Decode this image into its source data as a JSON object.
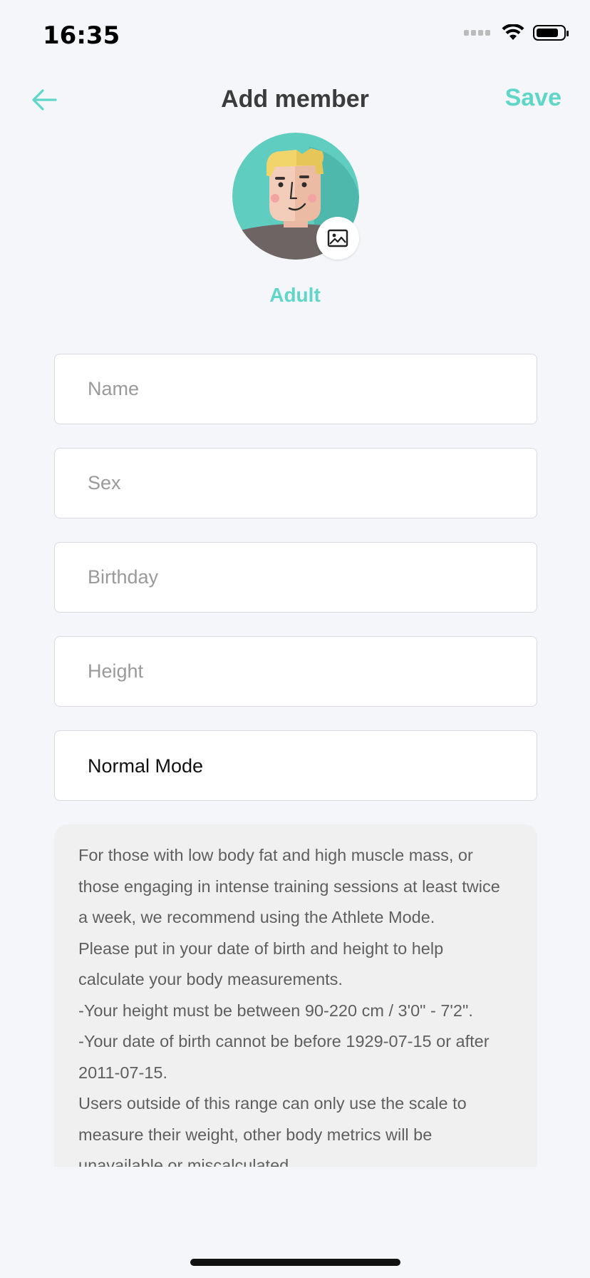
{
  "status_bar": {
    "time": "16:35"
  },
  "header": {
    "title": "Add member",
    "save_label": "Save",
    "back_icon": "arrow-left-icon"
  },
  "profile": {
    "avatar_icon": "cartoon-man-avatar",
    "photo_icon": "image-icon",
    "label": "Adult"
  },
  "form": {
    "name_placeholder": "Name",
    "sex_placeholder": "Sex",
    "birthday_placeholder": "Birthday",
    "height_placeholder": "Height",
    "mode_value": "Normal Mode"
  },
  "info": {
    "paragraphs": [
      "For those with low body fat and high muscle mass, or those engaging in intense training sessions at least twice a week, we recommend using the Athlete Mode.",
      "Please put in your date of birth and height to help calculate your body measurements.",
      "-Your height must be between 90-220 cm / 3'0\" - 7'2\".",
      "-Your date of birth cannot be before 1929-07-15 or after 2011-07-15.",
      "Users outside of this range can only use the scale to measure their weight, other body metrics will be unavailable or miscalculated."
    ]
  },
  "colors": {
    "accent": "#5fd6c8",
    "background": "#f4f6fa",
    "info_background": "#f0f0f0"
  }
}
